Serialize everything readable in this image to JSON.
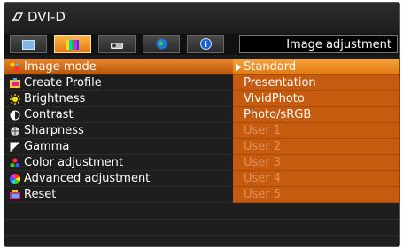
{
  "header": {
    "input_label": "DVI-D",
    "input_icon": "signal-input-icon"
  },
  "tabs": [
    {
      "icon": "screen-tab-icon",
      "active": false
    },
    {
      "icon": "color-bars-tab-icon",
      "active": true
    },
    {
      "icon": "projector-tab-icon",
      "active": false
    },
    {
      "icon": "globe-tab-icon",
      "active": false
    },
    {
      "icon": "info-tab-icon",
      "active": false
    }
  ],
  "panel_title": "Image adjustment",
  "menu": [
    {
      "label": "Image mode",
      "icon": "image-mode-icon"
    },
    {
      "label": "Create Profile",
      "icon": "create-profile-icon"
    },
    {
      "label": "Brightness",
      "icon": "brightness-icon"
    },
    {
      "label": "Contrast",
      "icon": "contrast-icon"
    },
    {
      "label": "Sharpness",
      "icon": "sharpness-icon"
    },
    {
      "label": "Gamma",
      "icon": "gamma-icon"
    },
    {
      "label": "Color adjustment",
      "icon": "color-adjustment-icon"
    },
    {
      "label": "Advanced adjustment",
      "icon": "advanced-adjustment-icon"
    },
    {
      "label": "Reset",
      "icon": "reset-icon"
    }
  ],
  "options": [
    {
      "label": "Standard",
      "selected": true,
      "enabled": true
    },
    {
      "label": "Presentation",
      "selected": false,
      "enabled": true
    },
    {
      "label": "VividPhoto",
      "selected": false,
      "enabled": true
    },
    {
      "label": "Photo/sRGB",
      "selected": false,
      "enabled": true
    },
    {
      "label": "User 1",
      "selected": false,
      "enabled": false
    },
    {
      "label": "User 2",
      "selected": false,
      "enabled": false
    },
    {
      "label": "User 3",
      "selected": false,
      "enabled": false
    },
    {
      "label": "User 4",
      "selected": false,
      "enabled": false
    },
    {
      "label": "User 5",
      "selected": false,
      "enabled": false
    }
  ],
  "colors": {
    "accent": "#e07a10",
    "value_bg": "#c65b10",
    "background": "#1a1a1a"
  }
}
